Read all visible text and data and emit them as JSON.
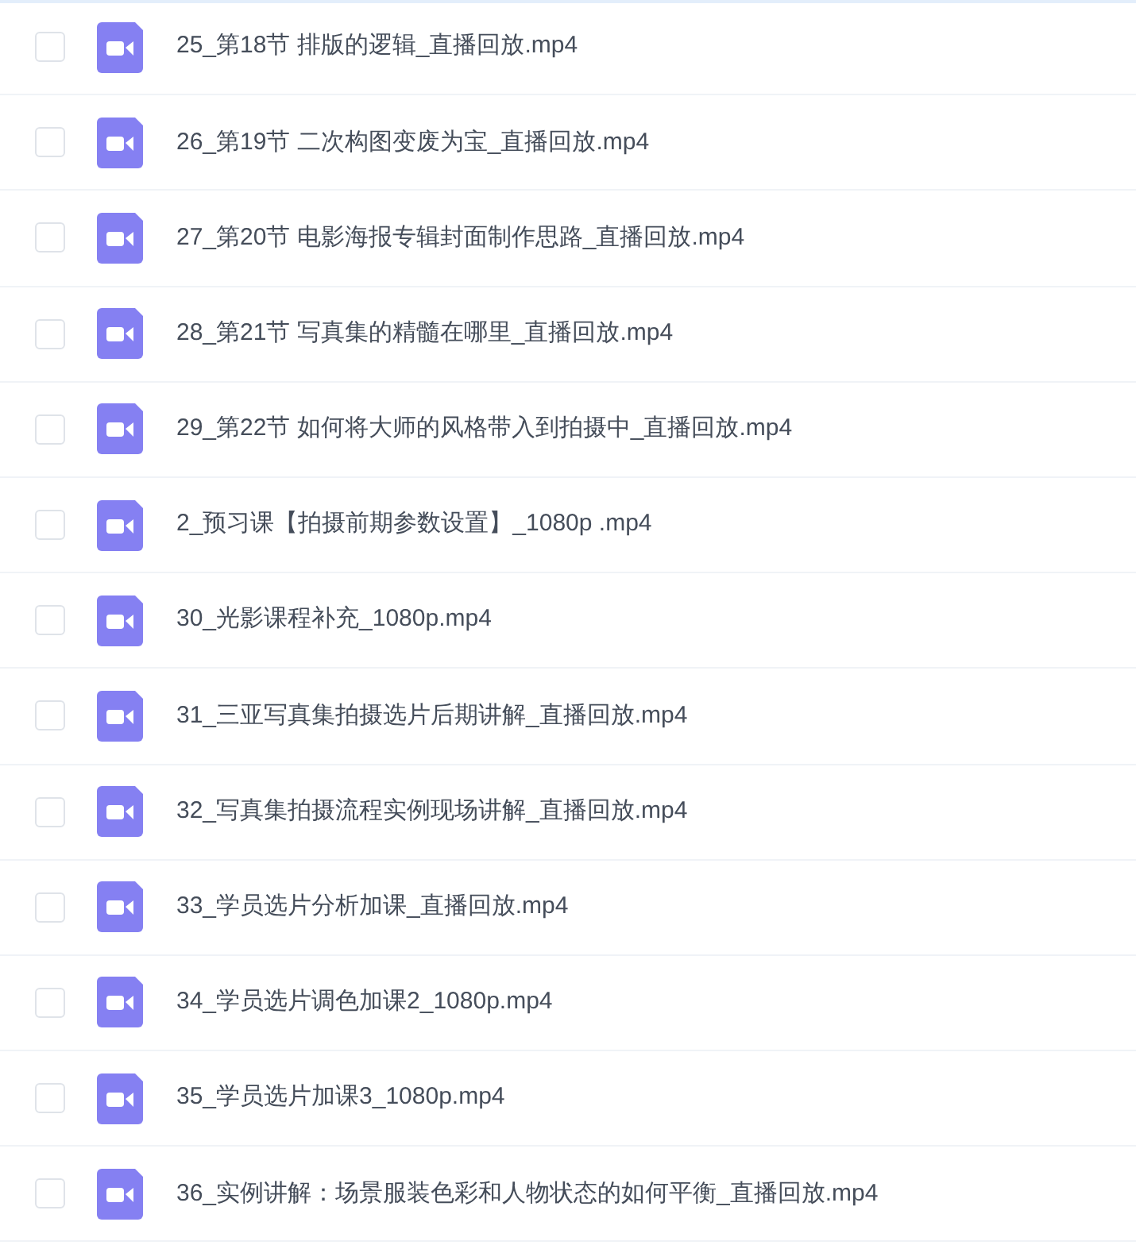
{
  "files": [
    {
      "name": "25_第18节 排版的逻辑_直播回放.mp4",
      "checked": false
    },
    {
      "name": "26_第19节 二次构图变废为宝_直播回放.mp4",
      "checked": false
    },
    {
      "name": "27_第20节 电影海报专辑封面制作思路_直播回放.mp4",
      "checked": false
    },
    {
      "name": "28_第21节 写真集的精髓在哪里_直播回放.mp4",
      "checked": false
    },
    {
      "name": "29_第22节 如何将大师的风格带入到拍摄中_直播回放.mp4",
      "checked": false
    },
    {
      "name": "2_预习课【拍摄前期参数设置】_1080p .mp4",
      "checked": false
    },
    {
      "name": "30_光影课程补充_1080p.mp4",
      "checked": false
    },
    {
      "name": "31_三亚写真集拍摄选片后期讲解_直播回放.mp4",
      "checked": false
    },
    {
      "name": "32_写真集拍摄流程实例现场讲解_直播回放.mp4",
      "checked": false
    },
    {
      "name": "33_学员选片分析加课_直播回放.mp4",
      "checked": false
    },
    {
      "name": "34_学员选片调色加课2_1080p.mp4",
      "checked": false
    },
    {
      "name": "35_学员选片加课3_1080p.mp4",
      "checked": false
    },
    {
      "name": "36_实例讲解：场景服装色彩和人物状态的如何平衡_直播回放.mp4",
      "checked": false
    }
  ]
}
